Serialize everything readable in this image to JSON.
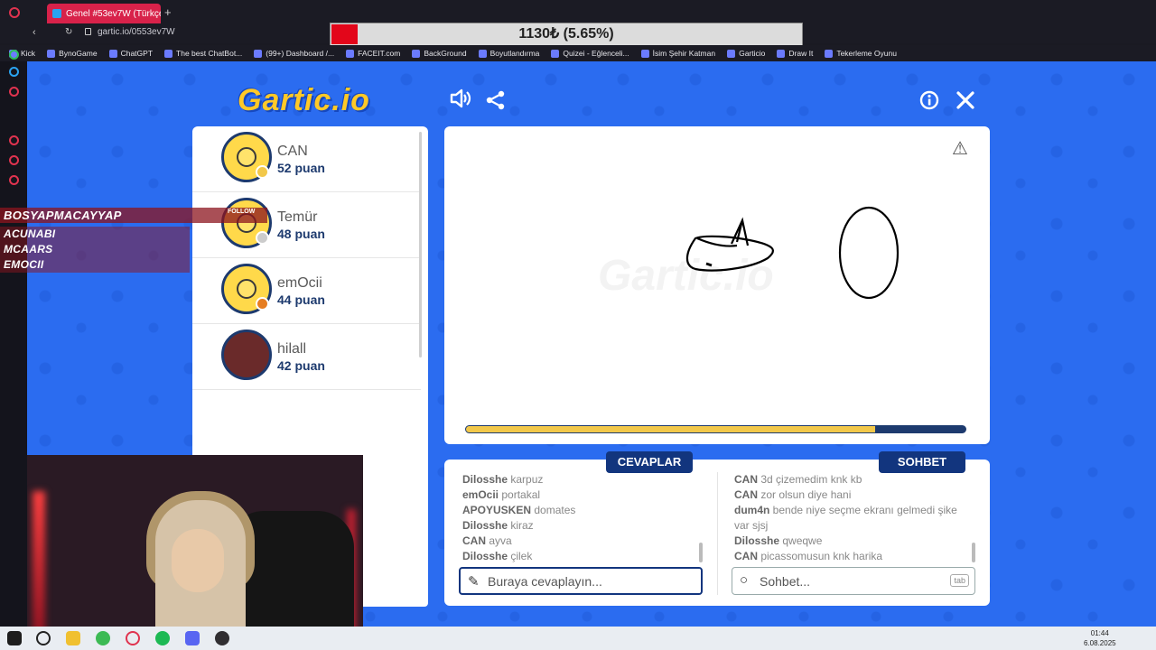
{
  "browser": {
    "tab_title": "Genel #53ev7W (Türkçe)",
    "url": "gartic.io/0553ev7W",
    "new_tab": "+",
    "bookmarks": [
      "Kick",
      "BynoGame",
      "ChatGPT",
      "The best ChatBot...",
      "(99+) Dashboard /...",
      "FACEIT.com",
      "BackGround",
      "Boyutlandırma",
      "Quizei - Eğlenceli...",
      "İsim Şehir Katman",
      "Garticio",
      "Draw It",
      "Tekerleme Oyunu"
    ]
  },
  "donation": {
    "text": "1130₺ (5.65%)",
    "progress_percent": 5.65
  },
  "game": {
    "logo": "Gartic.io",
    "watermark": "Gartic.io",
    "players": [
      {
        "name": "CAN",
        "score": "52 puan",
        "status_color": "#f2c84a"
      },
      {
        "name": "Temür",
        "score": "48 puan",
        "status_color": "#cccccc"
      },
      {
        "name": "emOcii",
        "score": "44 puan",
        "status_color": "#e67e22"
      },
      {
        "name": "hilall",
        "score": "42 puan",
        "status_color": ""
      }
    ],
    "timer_fraction": 0.82,
    "answers_label": "CEVAPLAR",
    "chat_label": "SOHBET",
    "answers": [
      {
        "user": "Dilosshe",
        "text": "karpuz"
      },
      {
        "user": "emOcii",
        "text": "portakal"
      },
      {
        "user": "APOYUSKEN",
        "text": "domates"
      },
      {
        "user": "Dilosshe",
        "text": "kiraz"
      },
      {
        "user": "CAN",
        "text": "ayva"
      },
      {
        "user": "Dilosshe",
        "text": "çilek"
      }
    ],
    "chat": [
      {
        "user": "CAN",
        "text": "3d çizemedim knk kb"
      },
      {
        "user": "CAN",
        "text": "zor olsun diye hani"
      },
      {
        "user": "dum4n",
        "text": "bende niye seçme ekranı gelmedi şike var sjsj"
      },
      {
        "user": "Dilosshe",
        "text": "qweqwe"
      },
      {
        "user": "CAN",
        "text": "picassomusun knk harika"
      }
    ],
    "answer_placeholder": "Buraya cevaplayın...",
    "chat_placeholder": "Sohbet...",
    "tab_key": "tab"
  },
  "stream_overlay": {
    "follow_label": "FOLLOW",
    "names": [
      "BOSYAPMACAYYAP",
      "ACUNABI",
      "MCAARS",
      "EMOCII"
    ]
  },
  "taskbar": {
    "time": "01:44",
    "date": "6.08.2025"
  },
  "icons": [
    "whatsapp-icon",
    "sound-icon",
    "share-icon",
    "info-icon",
    "close-icon",
    "warning-icon",
    "pencil-icon",
    "search-icon"
  ]
}
